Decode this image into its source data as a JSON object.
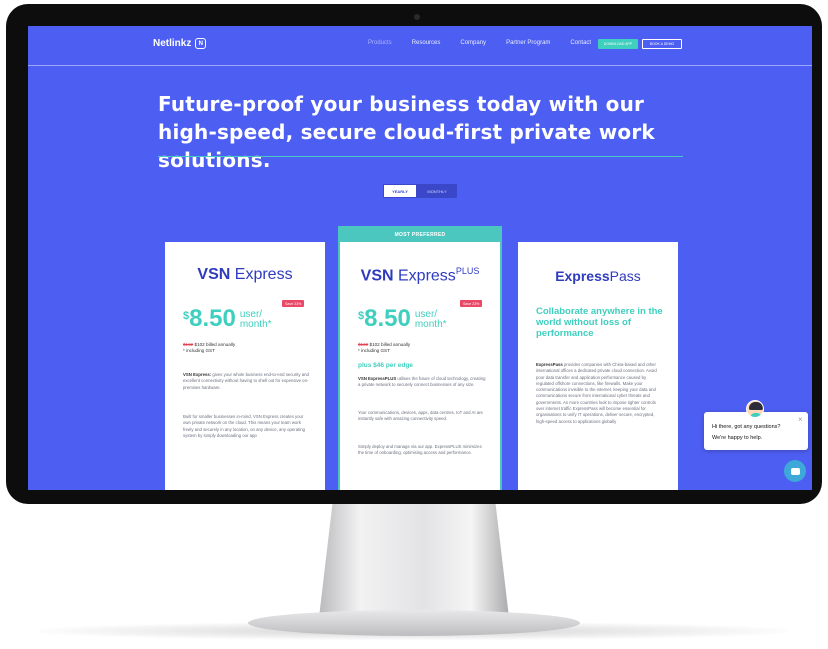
{
  "brand": {
    "name": "Netlinkz",
    "logo_glyph": "N"
  },
  "nav": {
    "items": [
      "Products",
      "Resources",
      "Company",
      "Partner Program",
      "Contact"
    ],
    "download_label": "DOWNLOAD APP",
    "demo_label": "BOOK A DEMO"
  },
  "hero": {
    "title": "Future-proof your business today with our high-speed, secure cloud-first private work solutions."
  },
  "billing_toggle": {
    "yearly": "YEARLY",
    "monthly": "MONTHLY"
  },
  "plans": [
    {
      "title_bold": "VSN",
      "title_rest": " Express",
      "currency": "$",
      "price": "8.50",
      "unit": "user/ month*",
      "save": "Save 23%",
      "billed_strike": "$132",
      "billed": "$102 billed annually",
      "gst": "* including GST",
      "p1_bold": "VSN Express:",
      "p1": " gives your whole business end-to-end security and excellent connectivity without having to shell out for expensive on-premises hardware.",
      "p2": "Built for smaller businesses in-mind, VSN Express creates your own private network on the cloud. This means your team work freely and securely in any location, on any device, any operating system by simply downloading our app"
    },
    {
      "banner": "MOST PREFERRED",
      "title_bold": "VSN",
      "title_rest": " Express",
      "title_sup": "PLUS",
      "currency": "$",
      "price": "8.50",
      "unit": "user/ month*",
      "save": "Save 23%",
      "billed_strike": "$132",
      "billed": "$102 billed annually",
      "gst": "* including GST",
      "plus": "plus $46 per edge",
      "p1_bold": "VSN ExpressPLUS",
      "p1": " utilises the future of cloud technology, creating a private network to securely connect businesses of any size.",
      "p2": "Your communications, devices, apps, data centres, IoT and AI are instantly safe with amazing connectivity speed.",
      "p3": "Simply deploy and manage via our app. ExpressPLUS minimizes the time of onboarding, optimising access and performance."
    },
    {
      "title_bold": "Express",
      "title_rest": "Pass",
      "subtitle": "Collaborate anywhere in the world without loss of performance",
      "p1_bold": "ExpressPass",
      "p1": " provides companies with China-based and other international offices a dedicated private cloud connection. Avoid poor data transfer and application performance caused by regulated offshore connections, like firewalls. Make your communications invisible to the internet, keeping your data and communications secure from international cyber threats and governments. As more countries look to impose tighter controls over internet traffic ExpressPass will become essential for organisations to unify IT operations, deliver secure, encrypted, high-speed access to applications globally"
    }
  ],
  "chat": {
    "line1": "Hi there, got any questions?",
    "line2": "We're happy to help.",
    "close": "×"
  },
  "colors": {
    "background": "#4d5ef2",
    "accent": "#3fcfbe",
    "heading": "#2e3bbf",
    "save_badge": "#e94866"
  }
}
